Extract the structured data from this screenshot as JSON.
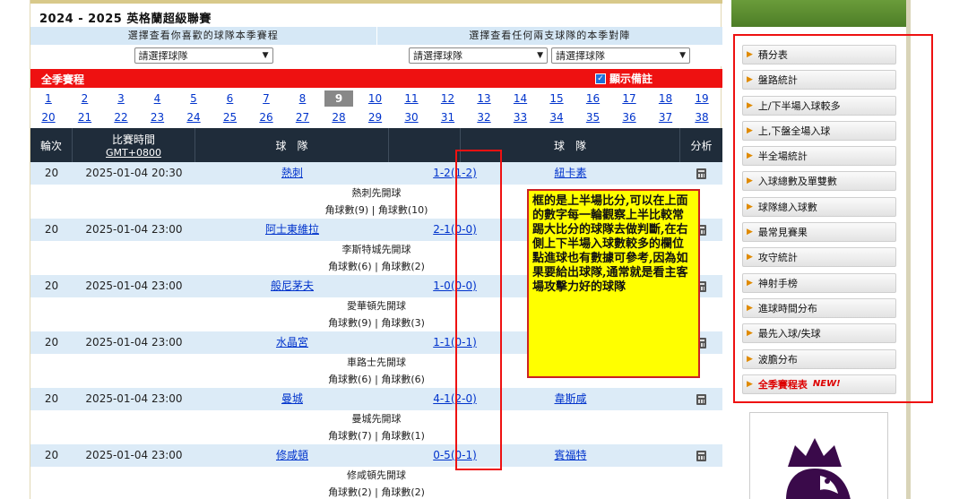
{
  "page": {
    "title": "2024 - 2025 英格蘭超級聯賽"
  },
  "selector": {
    "left_header": "選擇查看你喜歡的球隊本季賽程",
    "right_header": "選擇查看任何兩支球隊的本季對陣",
    "left_select": "請選擇球隊",
    "right_select_1": "請選擇球隊",
    "right_select_2": "請選擇球隊"
  },
  "season_bar": {
    "label": "全季賽程",
    "show_notes_label": "顯示備註",
    "show_notes_checked": true
  },
  "rounds_row1": [
    "1",
    "2",
    "3",
    "4",
    "5",
    "6",
    "7",
    "8",
    "9",
    "10",
    "11",
    "12",
    "13",
    "14",
    "15",
    "16",
    "17",
    "18",
    "19"
  ],
  "rounds_row2": [
    "20",
    "21",
    "22",
    "23",
    "24",
    "25",
    "26",
    "27",
    "28",
    "29",
    "30",
    "31",
    "32",
    "33",
    "34",
    "35",
    "36",
    "37",
    "38"
  ],
  "active_round": "9",
  "table_head": {
    "round": "輪次",
    "time": "比賽時間",
    "time_zone": "GMT+0800",
    "home": "球　隊",
    "away": "球　隊",
    "analysis": "分析"
  },
  "matches": [
    {
      "round": "20",
      "time": "2025-01-04 20:30",
      "home": "熱刺",
      "score": "1-2(1-2)",
      "away": "紐卡素",
      "note1": "熱刺先開球",
      "note2": "角球數(9) | 角球數(10)"
    },
    {
      "round": "20",
      "time": "2025-01-04 23:00",
      "home": "阿士東維拉",
      "score": "2-1(0-0)",
      "away": "",
      "note1": "李斯特城先開球",
      "note2": "角球數(6) | 角球數(2)"
    },
    {
      "round": "20",
      "time": "2025-01-04 23:00",
      "home": "般尼茅夫",
      "score": "1-0(0-0)",
      "away": "",
      "note1": "愛華頓先開球",
      "note2": "角球數(9) | 角球數(3)"
    },
    {
      "round": "20",
      "time": "2025-01-04 23:00",
      "home": "水晶宮",
      "score": "1-1(0-1)",
      "away": "",
      "note1": "車路士先開球",
      "note2": "角球數(6) | 角球數(6)"
    },
    {
      "round": "20",
      "time": "2025-01-04 23:00",
      "home": "曼城",
      "score": "4-1(2-0)",
      "away": "韋斯咸",
      "note1": "曼城先開球",
      "note2": "角球數(7) | 角球數(1)"
    },
    {
      "round": "20",
      "time": "2025-01-04 23:00",
      "home": "修咸頓",
      "score": "0-5(0-1)",
      "away": "賓福特",
      "note1": "修咸頓先開球",
      "note2": "角球數(2) | 角球數(2)"
    }
  ],
  "annotation": {
    "text": "框的是上半場比分,可以在上面的數字每一輪觀察上半比較常踢大比分的球隊去做判斷,在右側上下半場入球數較多的欄位點進球也有數據可參考,因為如果要給出球隊,通常就是看主客場攻擊力好的球隊"
  },
  "menu": [
    {
      "label": "積分表"
    },
    {
      "label": "盤路統計"
    },
    {
      "label": "上/下半場入球較多"
    },
    {
      "label": "上,下盤全場入球"
    },
    {
      "label": "半全場統計"
    },
    {
      "label": "入球總數及單雙數"
    },
    {
      "label": "球隊總入球數"
    },
    {
      "label": "最常見賽果"
    },
    {
      "label": "攻守統計"
    },
    {
      "label": "神射手榜"
    },
    {
      "label": "進球時間分布"
    },
    {
      "label": "最先入球/失球"
    },
    {
      "label": "波膽分布"
    },
    {
      "label": "全季賽程表",
      "badge": "NEW!",
      "hot": true
    }
  ],
  "colors": {
    "accent_red": "#ee1111",
    "header_dark": "#1f2c3a",
    "row_blue": "#dcebf7",
    "note_yellow": "#ffff00"
  }
}
